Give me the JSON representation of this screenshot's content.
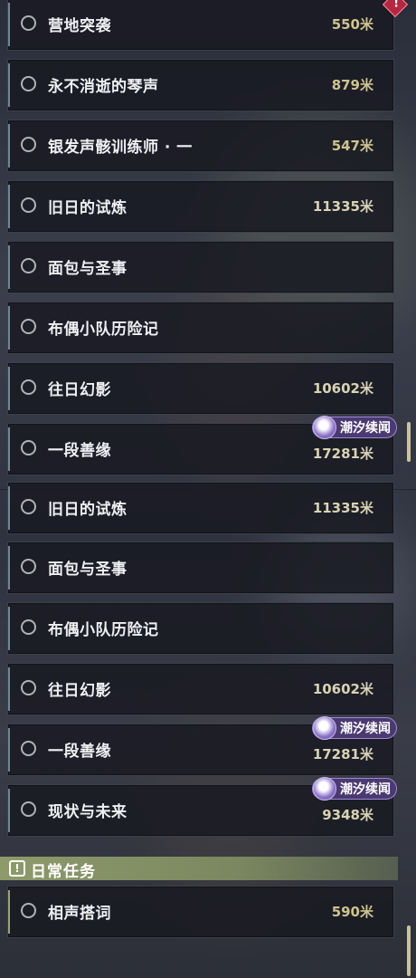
{
  "top_list": [
    {
      "title": "营地突袭",
      "distance": "550米",
      "alert": true
    },
    {
      "title": "永不消逝的琴声",
      "distance": "879米"
    },
    {
      "title": "银发声骸训练师 · 一",
      "distance": "547米"
    },
    {
      "title": "旧日的试炼",
      "distance": "11335米"
    },
    {
      "title": "面包与圣事",
      "distance": ""
    },
    {
      "title": "布偶小队历险记",
      "distance": ""
    },
    {
      "title": "往日幻影",
      "distance": "10602米"
    },
    {
      "title": "一段善缘",
      "distance": "17281米",
      "badge": "潮汐续闻"
    }
  ],
  "bottom_list": [
    {
      "title": "旧日的试炼",
      "distance": "11335米"
    },
    {
      "title": "面包与圣事",
      "distance": ""
    },
    {
      "title": "布偶小队历险记",
      "distance": ""
    },
    {
      "title": "往日幻影",
      "distance": "10602米"
    },
    {
      "title": "一段善缘",
      "distance": "17281米",
      "badge": "潮汐续闻"
    },
    {
      "title": "现状与未来",
      "distance": "9348米",
      "badge": "潮汐续闻"
    }
  ],
  "daily_section": {
    "header": "日常任务",
    "items": [
      {
        "title": "相声搭词",
        "distance": "590米"
      }
    ]
  },
  "colors": {
    "badge_purple": "#4b3a72",
    "daily_green": "#8e9a6a",
    "distance_gold": "#cfc48e",
    "alert_red": "#b32840"
  },
  "icons": {
    "radio": "radio-circle-icon",
    "badge": "tidal-sequel-icon",
    "alert": "alert-diamond-icon",
    "section": "exclamation-box-icon"
  }
}
